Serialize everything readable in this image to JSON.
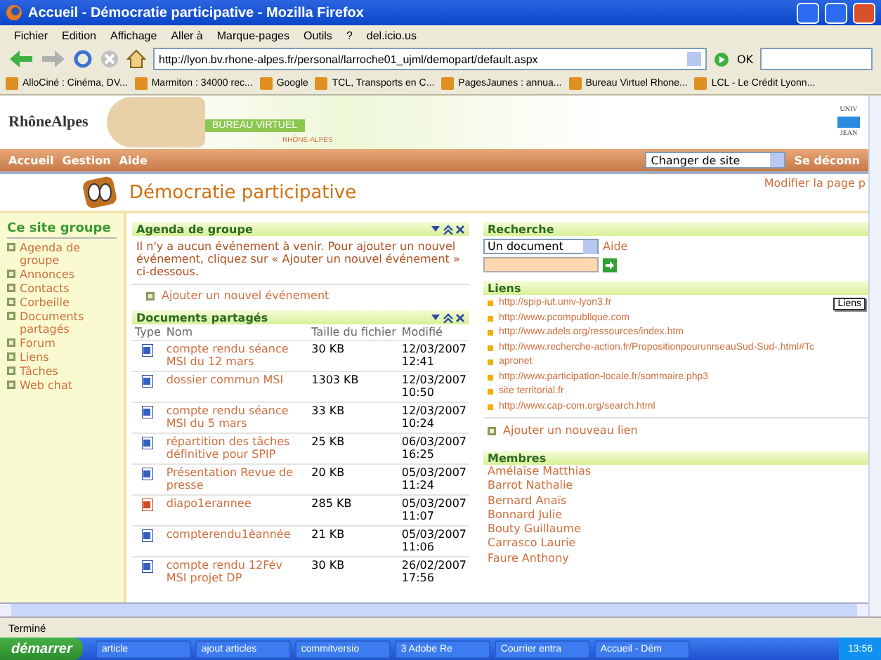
{
  "window": {
    "title": "Accueil - Démocratie participative - Mozilla Firefox"
  },
  "menu": [
    "Fichier",
    "Edition",
    "Affichage",
    "Aller à",
    "Marque-pages",
    "Outils",
    "?",
    "del.icio.us"
  ],
  "toolbar": {
    "url": "http://lyon.bv.rhone-alpes.fr/personal/larroche01_ujml/demopart/default.aspx",
    "go": "OK"
  },
  "bookmarks": [
    "AlloCiné : Cinéma, DV...",
    "Marmiton : 34000 rec...",
    "Google",
    "TCL, Transports en C...",
    "PagesJaunes : annua...",
    "Bureau Virtuel Rhone...",
    "LCL - Le Crédit Lyonn..."
  ],
  "banner": {
    "brand": "RhôneAlpes",
    "product": "BUREAU VIRTUEL",
    "region": "RHÔNE-ALPES",
    "univ_top": "UNIV",
    "univ_bottom": "JEAN"
  },
  "nav": {
    "items": [
      "Accueil",
      "Gestion",
      "Aide"
    ],
    "site_select": "Changer de site",
    "logout": "Se déconn"
  },
  "page": {
    "title": "Démocratie participative",
    "edit_link": "Modifier la page p"
  },
  "sidebar": {
    "heading": "Ce site groupe",
    "items": [
      "Agenda de groupe",
      "Annonces",
      "Contacts",
      "Corbeille",
      "Documents partagés",
      "Forum",
      "Liens",
      "Tâches",
      "Web chat"
    ]
  },
  "agenda": {
    "title": "Agenda de groupe",
    "message": "Il n'y a aucun événement à venir. Pour ajouter un nouvel événement, cliquez sur « Ajouter un nouvel événement » ci-dessous.",
    "add": "Ajouter un nouvel événement"
  },
  "documents": {
    "title": "Documents partagés",
    "columns": [
      "Type",
      "Nom",
      "Taille du fichier",
      "Modifié"
    ],
    "rows": [
      {
        "kind": "word",
        "name": "compte rendu séance MSI du 12 mars",
        "size": "30 KB",
        "date": "12/03/2007",
        "time": "12:41"
      },
      {
        "kind": "word",
        "name": "dossier commun MSI",
        "size": "1303 KB",
        "date": "12/03/2007",
        "time": "10:50"
      },
      {
        "kind": "word",
        "name": "compte rendu séance MSI du 5 mars",
        "size": "33 KB",
        "date": "12/03/2007",
        "time": "10:24"
      },
      {
        "kind": "word",
        "name": "répartition des tâches définitive pour SPIP",
        "size": "25 KB",
        "date": "06/03/2007",
        "time": "16:25"
      },
      {
        "kind": "word",
        "name": "Présentation Revue de presse",
        "size": "20 KB",
        "date": "05/03/2007",
        "time": "11:24"
      },
      {
        "kind": "slides",
        "name": "diapo1erannee",
        "size": "285 KB",
        "date": "05/03/2007",
        "time": "11:07"
      },
      {
        "kind": "word",
        "name": "compterendu1èannée",
        "size": "21 KB",
        "date": "05/03/2007",
        "time": "11:06"
      },
      {
        "kind": "word",
        "name": "compte rendu 12Fév MSI projet DP",
        "size": "30 KB",
        "date": "26/02/2007",
        "time": "17:56"
      }
    ]
  },
  "search": {
    "title": "Recherche",
    "scope": "Un document",
    "help": "Aide"
  },
  "links": {
    "title": "Liens",
    "tooltip": "Liens",
    "items": [
      "http://spip-iut.univ-lyon3.fr",
      "http://www.pcompublique.com",
      "http://www.adels.org/ressources/index.htm",
      "http://www.recherche-action.fr/PropositionpourunrseauSud-Sud-.html#Tc",
      "apronet",
      "http://www.participation-locale.fr/sommaire.php3",
      "site territorial.fr",
      "http://www.cap-com.org/search.html"
    ],
    "add": "Ajouter un nouveau lien"
  },
  "members": {
    "title": "Membres",
    "items": [
      "Amélaïse Matthias",
      "Barrot Nathalie",
      "Bernard Anaïs",
      "Bonnard Julie",
      "Bouty Guillaume",
      "Carrasco Laurie",
      "Faure Anthony"
    ]
  },
  "status_bar": "Terminé",
  "taskbar": {
    "start": "démarrer",
    "items": [
      "article",
      "ajout articles",
      "commitversio",
      "3 Adobe Re",
      "Courrier entra",
      "Accueil - Dém"
    ],
    "clock": "13:56"
  }
}
